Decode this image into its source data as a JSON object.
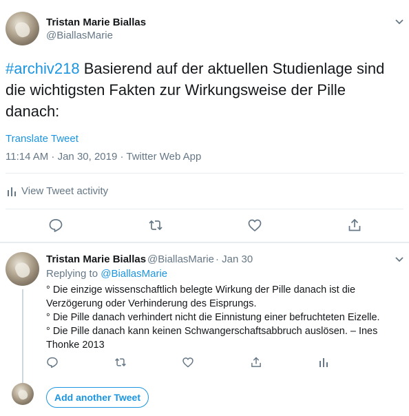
{
  "main_tweet": {
    "author_name": "Tristan Marie Biallas",
    "author_handle": "@BiallasMarie",
    "hashtag": "#archiv218",
    "text": " Basierend auf der aktuellen Studienlage sind die wichtigsten Fakten zur Wirkungsweise der Pille danach:",
    "translate_label": "Translate Tweet",
    "timestamp": "11:14 AM · Jan 30, 2019 · Twitter Web App",
    "activity_label": "View Tweet activity"
  },
  "reply_tweet": {
    "author_name": "Tristan Marie Biallas",
    "author_handle": "@BiallasMarie",
    "date": "· Jan 30",
    "replying_to_prefix": "Replying to ",
    "replying_to_handle": "@BiallasMarie",
    "lines": [
      "° Die einzige wissenschaftlich belegte Wirkung der Pille danach ist die Verzögerung oder Verhinderung des Eisprungs.",
      "° Die Pille danach verhindert nicht die Einnistung einer befruchteten Eizelle.",
      "° Die Pille danach kann keinen Schwangerschaftsabbruch auslösen. – Ines Thonke 2013"
    ]
  },
  "composer": {
    "add_tweet_label": "Add another Tweet"
  },
  "icons": [
    "chevron-down-icon",
    "bar-chart-icon",
    "reply-icon",
    "retweet-icon",
    "like-icon",
    "share-icon"
  ],
  "colors": {
    "accent": "#1b95e0",
    "text": "#14171a",
    "secondary": "#657786",
    "divider": "#e6ecf0"
  }
}
